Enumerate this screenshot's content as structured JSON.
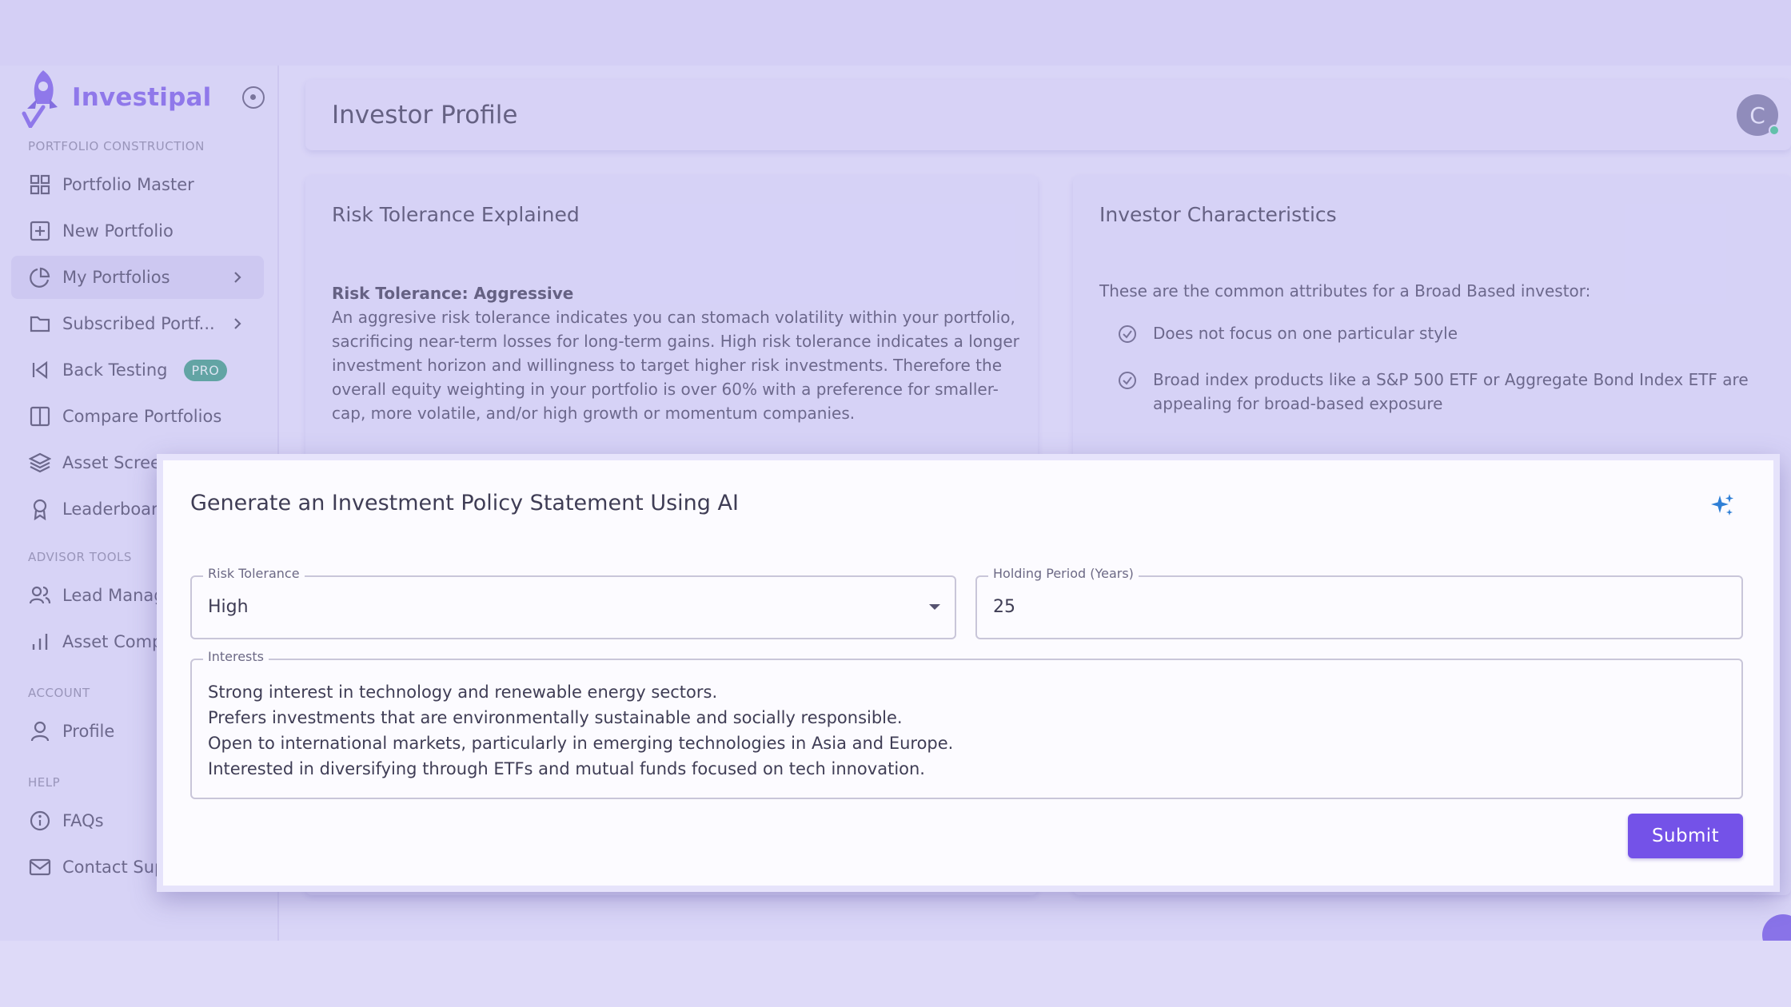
{
  "brand": {
    "name": "Investipal"
  },
  "sidebar": {
    "sections": {
      "portfolio_construction": "PORTFOLIO CONSTRUCTION",
      "advisor_tools": "ADVISOR TOOLS",
      "account": "ACCOUNT",
      "help": "HELP"
    },
    "items": [
      {
        "label": "Portfolio Master",
        "icon": "grid-icon"
      },
      {
        "label": "New Portfolio",
        "icon": "plus-square-icon"
      },
      {
        "label": "My Portfolios",
        "icon": "pie-chart-icon",
        "active": true
      },
      {
        "label": "Subscribed Portf...",
        "icon": "folder-icon"
      },
      {
        "label": "Back Testing",
        "icon": "skip-back-icon",
        "badge": "PRO"
      },
      {
        "label": "Compare Portfolios",
        "icon": "columns-icon"
      },
      {
        "label": "Asset Scree",
        "icon": "layers-icon"
      },
      {
        "label": "Leaderboar",
        "icon": "award-icon"
      },
      {
        "label": "Lead Manag",
        "icon": "users-icon"
      },
      {
        "label": "Asset Comp",
        "icon": "bar-chart-icon"
      },
      {
        "label": "Profile",
        "icon": "user-icon"
      },
      {
        "label": "FAQs",
        "icon": "info-icon"
      },
      {
        "label": "Contact Sup",
        "icon": "mail-icon"
      }
    ]
  },
  "header": {
    "title": "Investor Profile",
    "avatar_initial": "C"
  },
  "risk_card": {
    "title": "Risk Tolerance Explained",
    "heading": "Risk Tolerance: Aggressive",
    "body": "An aggresive risk tolerance indicates you can stomach volatility within your portfolio, sacrificing near-term losses for long-term gains. High risk tolerance indicates a longer investment horizon and willingness to target higher risk investments. Therefore the overall equity weighting in your portfolio is over 60% with a preference for smaller-cap, more volatile, and/or high growth or momentum companies."
  },
  "characteristics_card": {
    "title": "Investor Characteristics",
    "intro": "These are the common attributes for a Broad Based investor:",
    "items": [
      "Does not focus on one particular style",
      "Broad index products like a S&P 500 ETF or Aggregate Bond Index ETF are appealing for broad-based exposure"
    ]
  },
  "modal": {
    "title": "Generate an Investment Policy Statement Using AI",
    "risk_tolerance": {
      "label": "Risk Tolerance",
      "value": "High"
    },
    "holding_period": {
      "label": "Holding Period (Years)",
      "value": "25"
    },
    "interests": {
      "label": "Interests",
      "lines": [
        "Strong interest in technology and renewable energy sectors.",
        "Prefers investments that are environmentally sustainable and socially responsible.",
        "Open to international markets, particularly in emerging technologies in Asia and Europe.",
        "Interested in diversifying through ETFs and mutual funds focused on tech innovation."
      ]
    },
    "submit_label": "Submit"
  },
  "colors": {
    "accent": "#7452e8",
    "brand": "#7c5ee8",
    "pro_badge": "#3c9c84",
    "status_online": "#3cc48d",
    "sparkle": "#2f7fd6"
  }
}
